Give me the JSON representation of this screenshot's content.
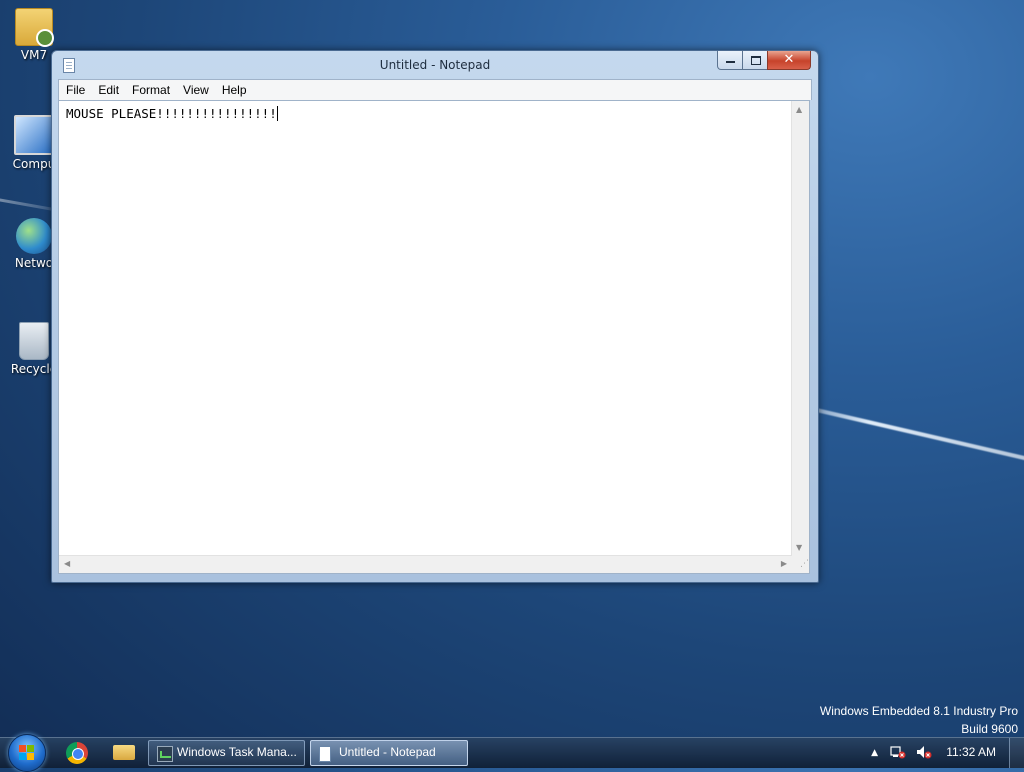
{
  "desktop": {
    "icons": [
      {
        "label": "VM7"
      },
      {
        "label": "Compu"
      },
      {
        "label": "Netwo"
      },
      {
        "label": "Recycle"
      }
    ],
    "watermark": {
      "line1": "Windows Embedded 8.1 Industry Pro",
      "line2": "Build 9600"
    }
  },
  "window": {
    "title": "Untitled - Notepad",
    "controls": {
      "close_glyph": "✕"
    },
    "menu": [
      "File",
      "Edit",
      "Format",
      "View",
      "Help"
    ],
    "content": "MOUSE PLEASE!!!!!!!!!!!!!!!!"
  },
  "taskbar": {
    "tasks": [
      {
        "label": "Windows Task Mana...",
        "active": false
      },
      {
        "label": "Untitled - Notepad",
        "active": true
      }
    ],
    "tray": {
      "overflow_glyph": "▲"
    },
    "clock": "11:32 AM"
  },
  "colors": {
    "desktop_bg": "#1d4678",
    "window_frame": "#b7cde6",
    "close_button": "#c7432b"
  }
}
